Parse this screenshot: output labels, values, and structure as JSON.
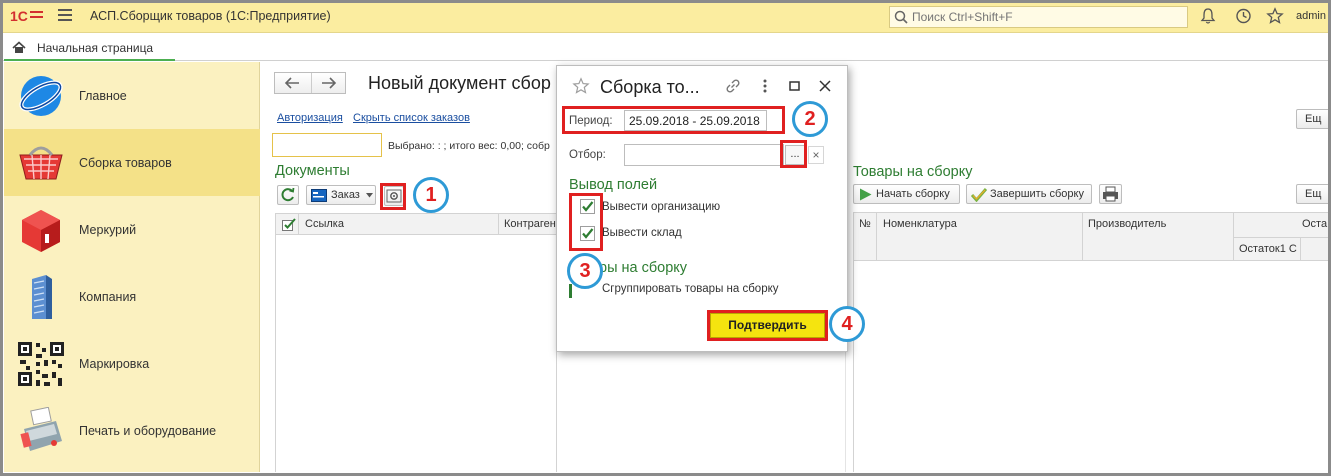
{
  "topbar": {
    "app_title": "АСП.Сборщик товаров  (1С:Предприятие)",
    "search_placeholder": "Поиск Ctrl+Shift+F",
    "username": "admin"
  },
  "tabs": {
    "home_label": "Начальная страница"
  },
  "sidebar": {
    "items": [
      {
        "label": "Главное",
        "icon": "globe-logo-icon"
      },
      {
        "label": "Сборка товаров",
        "icon": "basket-icon",
        "active": true
      },
      {
        "label": "Меркурий",
        "icon": "cube-icon"
      },
      {
        "label": "Компания",
        "icon": "building-icon"
      },
      {
        "label": "Маркировка",
        "icon": "qr-code-icon"
      },
      {
        "label": "Печать и оборудование",
        "icon": "pos-terminal-icon"
      }
    ]
  },
  "document": {
    "title": "Новый документ сбор",
    "links": {
      "auth": "Авторизация",
      "hide_orders": "Скрыть список заказов"
    },
    "selected_info": "Выбрано: : ; итого вес: 0,00; собр",
    "documents_title": "Документы",
    "order_button": "Заказ",
    "columns": {
      "link": "Ссылка",
      "counterparty": "Контраген"
    }
  },
  "goods": {
    "title": "Товары на сборку",
    "start_button": "Начать сборку",
    "finish_button": "Завершить сборку",
    "more_button": "Ещ",
    "columns": {
      "num": "№",
      "nomenclature": "Номенклатура",
      "manufacturer": "Производитель",
      "remains": "Оста",
      "remains1": "Остаток1 С"
    }
  },
  "dialog": {
    "title": "Сборка то...",
    "period_label": "Период:",
    "period_value": "25.09.2018 - 25.09.2018",
    "filter_label": "Отбор:",
    "filter_button": "...",
    "clear_button": "×",
    "output_fields_title": "Вывод полей",
    "check_org": "Вывести организацию",
    "check_warehouse": "Вывести склад",
    "goods_section_title": "ры на сборку",
    "group_label": "Сгруппировать товары на сборку",
    "confirm_button": "Подтвердить"
  },
  "callouts": [
    "1",
    "2",
    "3",
    "4"
  ],
  "colors": {
    "accent_green": "#2e7d32",
    "callout_red": "#e02020",
    "callout_blue": "#2e9ad6",
    "confirm_yellow": "#f5e40f",
    "topbar_yellow": "#fbeda0"
  }
}
